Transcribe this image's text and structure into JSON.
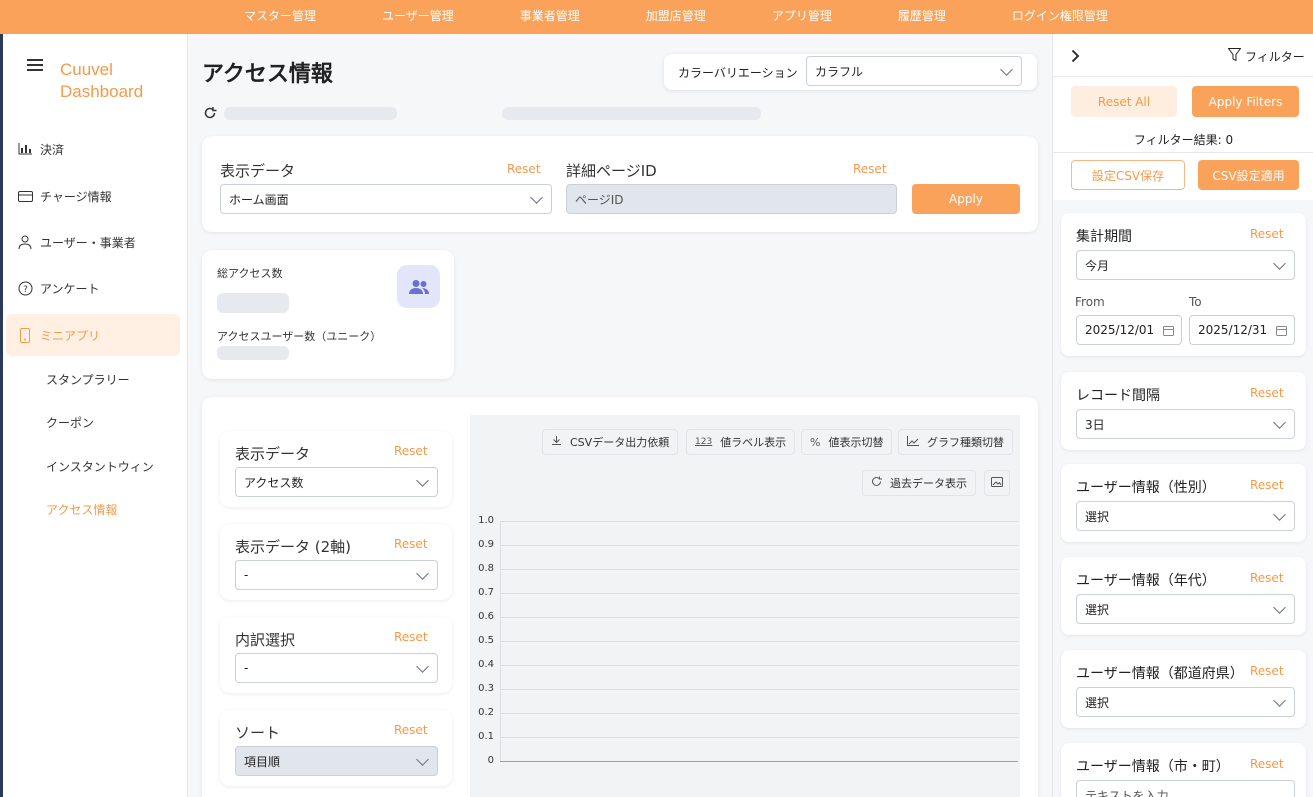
{
  "topnav": [
    "マスター管理",
    "ユーザー管理",
    "事業者管理",
    "加盟店管理",
    "アプリ管理",
    "履歴管理",
    "ログイン権限管理"
  ],
  "brand": {
    "line1": "Cuuvel",
    "line2": "Dashboard"
  },
  "sidebar": {
    "items": [
      {
        "label": "決済",
        "icon": "bar-chart-icon"
      },
      {
        "label": "チャージ情報",
        "icon": "card-icon"
      },
      {
        "label": "ユーザー・事業者",
        "icon": "user-icon"
      },
      {
        "label": "アンケート",
        "icon": "question-icon"
      },
      {
        "label": "ミニアプリ",
        "icon": "phone-icon"
      }
    ],
    "subitems": [
      "スタンプラリー",
      "クーポン",
      "インスタントウィン",
      "アクセス情報"
    ]
  },
  "page": {
    "title": "アクセス情報"
  },
  "color": {
    "label": "カラーバリエーション",
    "value": "カラフル"
  },
  "filter": {
    "display_label": "表示データ",
    "display_reset": "Reset",
    "display_value": "ホーム画面",
    "detail_label": "詳細ページID",
    "detail_reset": "Reset",
    "detail_placeholder": "ページID",
    "apply": "Apply"
  },
  "stats": {
    "total_label": "総アクセス数",
    "unique_label": "アクセスユーザー数（ユニーク）"
  },
  "chartctrl": {
    "c1_label": "表示データ",
    "c1_value": "アクセス数",
    "c2_label": "表示データ (2軸)",
    "c2_value": "-",
    "c3_label": "内訳選択",
    "c3_value": "-",
    "c4_label": "ソート",
    "c4_value": "項目順",
    "reset": "Reset"
  },
  "toolbar": {
    "csv": "CSVデータ出力依頼",
    "csv_icon": "download-icon",
    "label_icon_text": "123",
    "label": "値ラベル表示",
    "pct_icon": "%",
    "pct": "値表示切替",
    "type": "グラフ種類切替",
    "type_icon": "line-chart-icon",
    "past": "過去データ表示",
    "past_icon": "refresh-icon",
    "image_icon": "image-icon"
  },
  "chart_data": {
    "type": "line",
    "categories": [],
    "series": [],
    "title": "",
    "xlabel": "",
    "ylabel": "",
    "ylim": [
      0,
      1.0
    ],
    "yticks": [
      "1.0",
      "0.9",
      "0.8",
      "0.7",
      "0.6",
      "0.5",
      "0.4",
      "0.3",
      "0.2",
      "0.1",
      "0"
    ],
    "grid": true
  },
  "rpanel": {
    "filter_title": "フィルター",
    "reset_all": "Reset All",
    "apply_filters": "Apply Filters",
    "result_text": "フィルター結果: 0",
    "save_csv": "設定CSV保存",
    "apply_csv": "CSV設定適用",
    "period_label": "集計期間",
    "period_value": "今月",
    "from_label": "From",
    "to_label": "To",
    "from_value": "2025/12/01",
    "to_value": "2025/12/31",
    "interval_label": "レコード間隔",
    "interval_value": "3日",
    "gender_label": "ユーザー情報（性別）",
    "gender_value": "選択",
    "age_label": "ユーザー情報（年代）",
    "age_value": "選択",
    "pref_label": "ユーザー情報（都道府県）",
    "pref_value": "選択",
    "city_label": "ユーザー情報（市・町）",
    "city_placeholder": "テキストを入力",
    "reset": "Reset"
  },
  "colors": {
    "accent": "#fba25a",
    "accent_text": "#f59a4a"
  }
}
